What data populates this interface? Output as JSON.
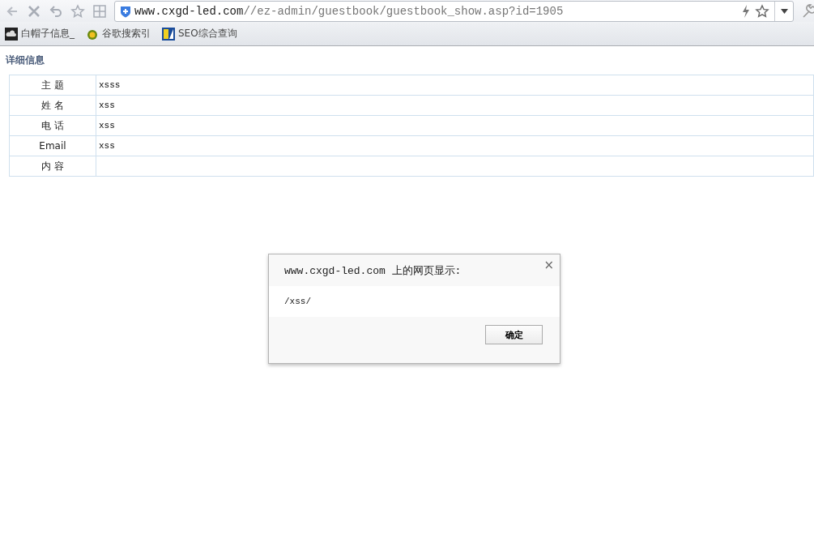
{
  "address_bar": {
    "host": "www.cxgd-led.com",
    "path": "//ez-admin/guestbook/guestbook_show.asp?id=1905"
  },
  "bookmarks": [
    {
      "label": "白帽子信息_",
      "kind": "cloud"
    },
    {
      "label": "谷歌搜索引",
      "kind": "bee"
    },
    {
      "label": "SEO综合查询",
      "kind": "seo"
    }
  ],
  "page": {
    "heading": "详细信息",
    "rows": [
      {
        "label": "主 题",
        "value": "xsss"
      },
      {
        "label": "姓 名",
        "value": "xss"
      },
      {
        "label": "电 话",
        "value": "xss"
      },
      {
        "label": "Email",
        "value": "xss"
      },
      {
        "label": "内 容"
      }
    ]
  },
  "dialog": {
    "title": "www.cxgd-led.com 上的网页显示:",
    "close": "×",
    "message": "/xss/",
    "button": "确定"
  }
}
